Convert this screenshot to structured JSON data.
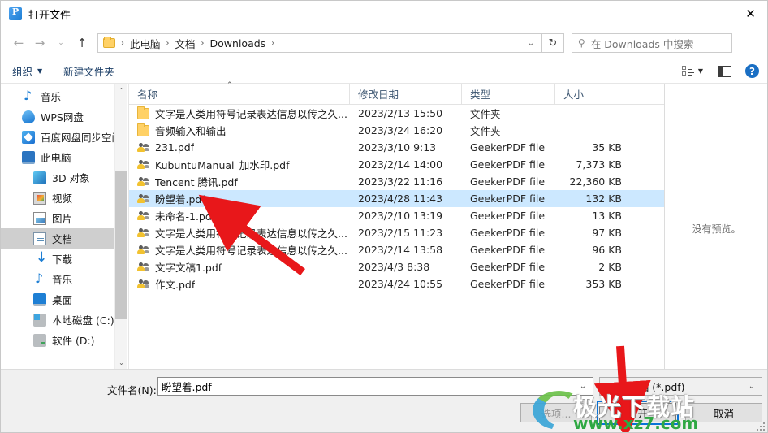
{
  "window": {
    "title": "打开文件",
    "app_icon": "pdf-app-icon",
    "close_label": "✕"
  },
  "nav": {
    "back": "←",
    "forward": "→",
    "recent": "⌄",
    "up": "↑",
    "breadcrumb": [
      "此电脑",
      "文档",
      "Downloads"
    ],
    "separator": "›",
    "dropdown": "⌄",
    "refresh": "↻"
  },
  "search": {
    "placeholder": "在 Downloads 中搜索",
    "icon": "search-icon"
  },
  "command_bar": {
    "organize": "组织",
    "organize_caret": "▼",
    "new_folder": "新建文件夹",
    "view_caret": "▼",
    "help": "?"
  },
  "sidebar": {
    "items": [
      {
        "label": "音乐",
        "icon": "music-icon",
        "level": 0,
        "selected": false
      },
      {
        "label": "WPS网盘",
        "icon": "wps-cloud-icon",
        "level": 0,
        "selected": false
      },
      {
        "label": "百度网盘同步空间",
        "icon": "baidu-cloud-icon",
        "level": 0,
        "selected": false
      },
      {
        "label": "此电脑",
        "icon": "this-pc-icon",
        "level": 0,
        "selected": false
      },
      {
        "label": "3D 对象",
        "icon": "3d-objects-icon",
        "level": 1,
        "selected": false
      },
      {
        "label": "视频",
        "icon": "videos-icon",
        "level": 1,
        "selected": false
      },
      {
        "label": "图片",
        "icon": "pictures-icon",
        "level": 1,
        "selected": false
      },
      {
        "label": "文档",
        "icon": "documents-icon",
        "level": 1,
        "selected": true
      },
      {
        "label": "下载",
        "icon": "downloads-icon",
        "level": 1,
        "selected": false
      },
      {
        "label": "音乐",
        "icon": "music-icon",
        "level": 1,
        "selected": false
      },
      {
        "label": "桌面",
        "icon": "desktop-icon",
        "level": 1,
        "selected": false
      },
      {
        "label": "本地磁盘 (C:)",
        "icon": "local-disk-icon",
        "level": 1,
        "selected": false
      },
      {
        "label": "软件 (D:)",
        "icon": "disk-icon",
        "level": 1,
        "selected": false
      }
    ],
    "scroll_up": "⌃",
    "scroll_down": "⌄"
  },
  "file_list": {
    "columns": [
      "名称",
      "修改日期",
      "类型",
      "大小"
    ],
    "sort_indicator": "⌃",
    "rows": [
      {
        "name": "文字是人类用符号记录表达信息以传之久...",
        "date": "2023/2/13 15:50",
        "type": "文件夹",
        "size": "",
        "icon": "folder-icon",
        "selected": false
      },
      {
        "name": "音频输入和输出",
        "date": "2023/3/24 16:20",
        "type": "文件夹",
        "size": "",
        "icon": "folder-icon",
        "selected": false
      },
      {
        "name": "231.pdf",
        "date": "2023/3/10 9:13",
        "type": "GeekerPDF file",
        "size": "35 KB",
        "icon": "pdf-file-icon",
        "selected": false
      },
      {
        "name": "KubuntuManual_加水印.pdf",
        "date": "2023/2/14 14:00",
        "type": "GeekerPDF file",
        "size": "7,373 KB",
        "icon": "pdf-file-icon",
        "selected": false
      },
      {
        "name": "Tencent 腾讯.pdf",
        "date": "2023/3/22 11:16",
        "type": "GeekerPDF file",
        "size": "22,360 KB",
        "icon": "pdf-file-icon",
        "selected": false
      },
      {
        "name": "盼望着.pdf",
        "date": "2023/4/28 11:43",
        "type": "GeekerPDF file",
        "size": "132 KB",
        "icon": "pdf-file-icon",
        "selected": true
      },
      {
        "name": "未命名-1.pdf",
        "date": "2023/2/10 13:19",
        "type": "GeekerPDF file",
        "size": "13 KB",
        "icon": "pdf-file-icon",
        "selected": false
      },
      {
        "name": "文字是人类用符号记录表达信息以传之久...",
        "date": "2023/2/15 11:23",
        "type": "GeekerPDF file",
        "size": "97 KB",
        "icon": "pdf-file-icon",
        "selected": false
      },
      {
        "name": "文字是人类用符号记录表达信息以传之久...",
        "date": "2023/2/14 13:58",
        "type": "GeekerPDF file",
        "size": "96 KB",
        "icon": "pdf-file-icon",
        "selected": false
      },
      {
        "name": "文字文稿1.pdf",
        "date": "2023/4/3 8:38",
        "type": "GeekerPDF file",
        "size": "2 KB",
        "icon": "pdf-file-icon",
        "selected": false
      },
      {
        "name": "作文.pdf",
        "date": "2023/4/24 10:55",
        "type": "GeekerPDF file",
        "size": "353 KB",
        "icon": "pdf-file-icon",
        "selected": false
      }
    ]
  },
  "preview": {
    "text": "没有预览。"
  },
  "footer": {
    "filename_label": "文件名(N):",
    "filename_value": "盼望着.pdf",
    "filename_caret": "⌄",
    "filetype_value": "PDF 文档 (*.pdf)",
    "filetype_caret": "⌄",
    "options_label": "选项...",
    "open_label": "打开",
    "cancel_label": "取消"
  },
  "watermark": {
    "title": "极光下载站",
    "url": "www.xz7.com"
  },
  "colors": {
    "selection": "#cce8ff",
    "accent": "#0a73d8",
    "annotation": "#e8171a",
    "header_text": "#3f5873"
  }
}
